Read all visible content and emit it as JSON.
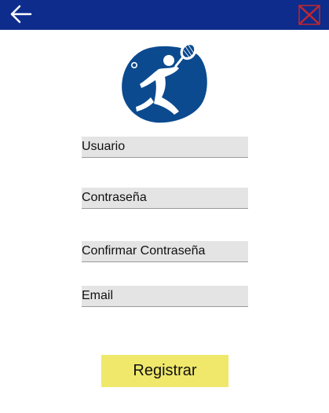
{
  "header": {
    "back_icon": "arrow-left-icon",
    "close_icon": "close-x-icon",
    "bar_color": "#0d2c8c",
    "close_color": "#c0272d"
  },
  "logo": {
    "icon": "tennis-player-icon",
    "color": "#0b4a8f"
  },
  "form": {
    "username_label": "Usuario",
    "password_label": "Contraseña",
    "confirm_password_label": "Confirmar Contraseña",
    "email_label": "Email"
  },
  "actions": {
    "register_label": "Registrar",
    "register_color": "#efe86a"
  }
}
